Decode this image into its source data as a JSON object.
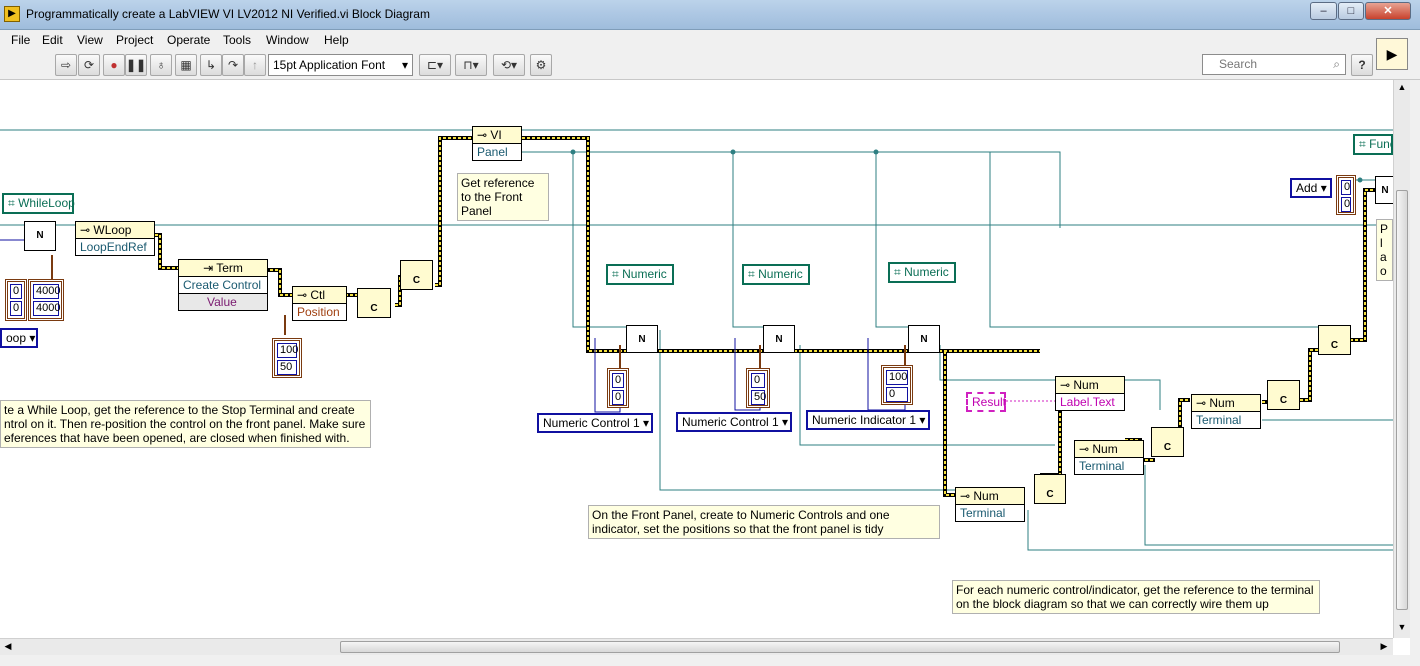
{
  "window": {
    "title": "Programmatically create a LabVIEW VI LV2012 NI Verified.vi Block Diagram",
    "controls": [
      "–",
      "□",
      "✕"
    ]
  },
  "menubar": {
    "items": [
      "File",
      "Edit",
      "View",
      "Project",
      "Operate",
      "Tools",
      "Window",
      "Help"
    ]
  },
  "toolbar": {
    "font_select": "15pt Application Font",
    "search_placeholder": "Search",
    "help_label": "?"
  },
  "diagram": {
    "class_constants": {
      "whileloop": "WhileLoop",
      "numeric_1": "Numeric",
      "numeric_2": "Numeric",
      "numeric_3": "Numeric",
      "func": "Func"
    },
    "property_nodes": {
      "wloop_head": "WLoop",
      "wloop_prop": "LoopEndRef",
      "term_head": "Term",
      "term_prop1": "Create Control",
      "term_prop2": "Value",
      "ctl_head": "Ctl",
      "ctl_prop": "Position",
      "vi_head": "VI",
      "vi_prop": "Panel",
      "num1_head": "Num",
      "num1_prop": "Label.Text",
      "num2_head": "Num",
      "num2_prop": "Terminal",
      "num3_head": "Num",
      "num3_prop": "Terminal",
      "num4_head": "Num",
      "num4_prop": "Terminal"
    },
    "enums": {
      "loop_enum": "oop",
      "numeric_control_1a": "Numeric Control 1",
      "numeric_control_1b": "Numeric Control 1",
      "numeric_indicator_1": "Numeric Indicator 1",
      "add_enum": "Add"
    },
    "clusters": {
      "c1_a": "0",
      "c1_b": "0",
      "c2_a": "4000",
      "c2_b": "4000",
      "c3_a": "100",
      "c3_b": "50",
      "c4_a": "0",
      "c4_b": "0",
      "c5_a": "0",
      "c5_b": "50",
      "c6_a": "100",
      "c6_b": "0",
      "c7_a": "0",
      "c7_b": "0"
    },
    "string_const": "Result",
    "comments": {
      "while_loop": "te a While Loop, get the reference to the Stop Terminal and create ntrol on it. Then re-position the control on the front panel. Make sure eferences that have been opened, are closed when finished with.",
      "front_panel_ref": "Get reference to the Front Panel",
      "numeric_controls": "On the Front Panel, create to Numeric Controls and one indicator, set the positions so that the front panel is tidy",
      "terminal_refs": "For each numeric control/indicator, get the reference to the terminal on the block diagram so that we can correctly wire them up",
      "right_edge": "Pla on an to"
    },
    "node_glyphs": {
      "new": "N",
      "close": "C"
    }
  }
}
